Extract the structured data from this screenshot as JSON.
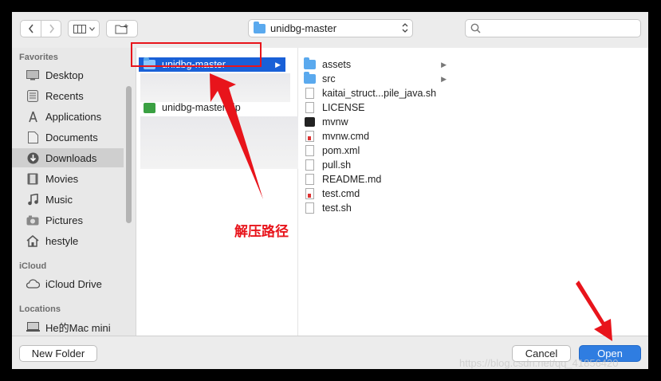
{
  "toolbar": {
    "path_popup": "unidbg-master",
    "search_placeholder": ""
  },
  "sidebar": {
    "favorites_header": "Favorites",
    "favorites": [
      {
        "label": "Desktop",
        "icon": "desktop-icon"
      },
      {
        "label": "Recents",
        "icon": "recents-icon"
      },
      {
        "label": "Applications",
        "icon": "applications-icon"
      },
      {
        "label": "Documents",
        "icon": "documents-icon"
      },
      {
        "label": "Downloads",
        "icon": "downloads-icon",
        "selected": true
      },
      {
        "label": "Movies",
        "icon": "movies-icon"
      },
      {
        "label": "Music",
        "icon": "music-icon"
      },
      {
        "label": "Pictures",
        "icon": "pictures-icon"
      },
      {
        "label": "hestyle",
        "icon": "home-icon"
      }
    ],
    "icloud_header": "iCloud",
    "icloud": [
      {
        "label": "iCloud Drive",
        "icon": "cloud-icon"
      }
    ],
    "locations_header": "Locations",
    "locations": [
      {
        "label": "He的Mac mini",
        "icon": "computer-icon"
      }
    ]
  },
  "column1": {
    "selected_folder": "unidbg-master",
    "zip_file": "unidbg-master.zip"
  },
  "column2": {
    "items": [
      {
        "label": "assets",
        "kind": "folder"
      },
      {
        "label": "src",
        "kind": "folder"
      },
      {
        "label": "kaitai_struct...pile_java.sh",
        "kind": "doc"
      },
      {
        "label": "LICENSE",
        "kind": "doc"
      },
      {
        "label": "mvnw",
        "kind": "exec"
      },
      {
        "label": "mvnw.cmd",
        "kind": "cmd"
      },
      {
        "label": "pom.xml",
        "kind": "doc"
      },
      {
        "label": "pull.sh",
        "kind": "doc"
      },
      {
        "label": "README.md",
        "kind": "doc"
      },
      {
        "label": "test.cmd",
        "kind": "cmd"
      },
      {
        "label": "test.sh",
        "kind": "doc"
      }
    ]
  },
  "buttons": {
    "new_folder": "New Folder",
    "cancel": "Cancel",
    "open": "Open"
  },
  "annotation": {
    "text": "解压路径",
    "color": "#e8141b"
  },
  "watermark": "https://blog.csdn.net/qq_41856420",
  "colors": {
    "selection": "#1960d7",
    "open_button": "#2f7de1"
  }
}
